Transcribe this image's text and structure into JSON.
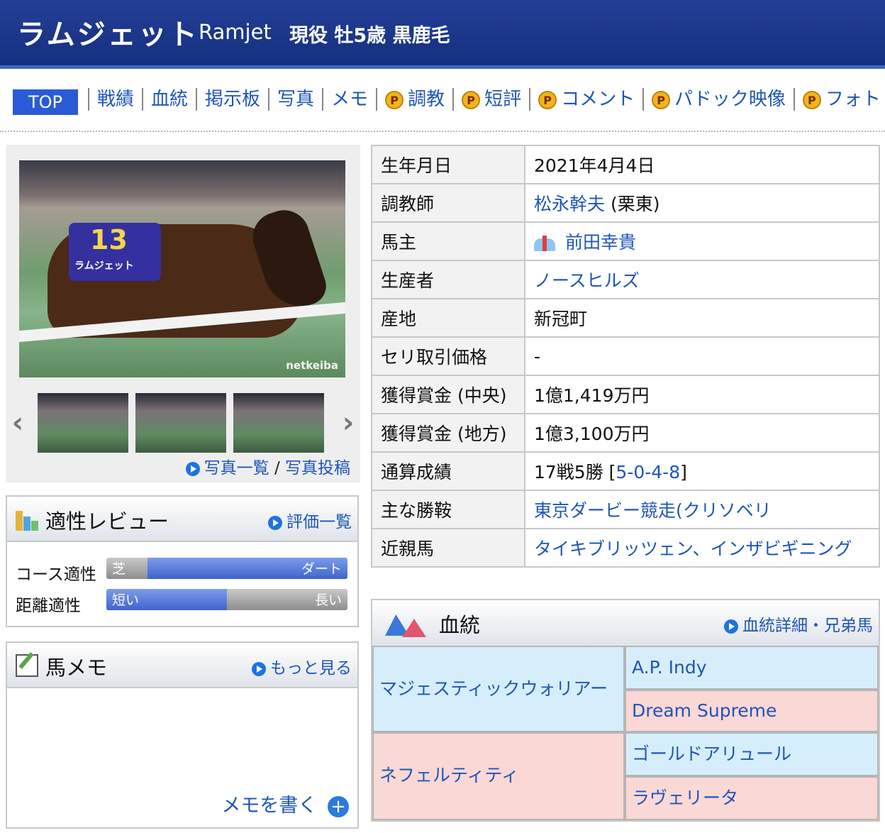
{
  "header": {
    "name_jp": "ラムジェット",
    "name_en": "Ramjet",
    "status": "現役 牡5歳 黒鹿毛"
  },
  "nav": {
    "top": "TOP",
    "items": [
      "戦績",
      "血統",
      "掲示板",
      "写真",
      "メモ"
    ],
    "premium_items": [
      "調教",
      "短評",
      "コメント",
      "パドック映像",
      "フォト"
    ],
    "premium_badge": "P"
  },
  "photo": {
    "watermark": "netkeiba",
    "cloth_number": "13",
    "cloth_name": "ラムジェット",
    "links": [
      "写真一覧",
      "写真投稿"
    ],
    "separator": "/"
  },
  "aptitude": {
    "title": "適性レビュー",
    "link": "評価一覧",
    "rows": [
      {
        "label": "コース適性",
        "left": "芝",
        "right": "ダート",
        "value": 0.83
      },
      {
        "label": "距離適性",
        "left": "短い",
        "right": "長い",
        "value": 0.5
      }
    ]
  },
  "memo": {
    "title": "馬メモ",
    "link": "もっと見る",
    "write": "メモを書く"
  },
  "info": [
    {
      "key": "生年月日",
      "value": "2021年4月4日"
    },
    {
      "key": "調教師",
      "value": "松永幹夫",
      "suffix": " (栗東)"
    },
    {
      "key": "馬主",
      "value": "前田幸貴"
    },
    {
      "key": "生産者",
      "value": "ノースヒルズ"
    },
    {
      "key": "産地",
      "value": "新冠町"
    },
    {
      "key": "セリ取引価格",
      "value": "-"
    },
    {
      "key": "獲得賞金 (中央)",
      "value": "1億1,419万円"
    },
    {
      "key": "獲得賞金 (地方)",
      "value": "1億3,100万円"
    },
    {
      "key": "通算成績",
      "value": "17戦5勝 [",
      "record": "5-0-4-8",
      "suffix": "]"
    },
    {
      "key": "主な勝鞍",
      "value": "東京ダービー競走(クリソベリ"
    },
    {
      "key": "近親馬",
      "value": "タイキブリッツェン、インザビギニング"
    }
  ],
  "pedigree": {
    "title": "血統",
    "link": "血統詳細・兄弟馬",
    "sire": "マジェスティックウォリアー",
    "dam": "ネフェルティティ",
    "sire_sire": "A.P. Indy",
    "sire_dam": "Dream Supreme",
    "dam_sire": "ゴールドアリュール",
    "dam_dam": "ラヴェリータ"
  },
  "colors": {
    "header": "#1c3a8c",
    "link": "#1f55b8",
    "accent": "#2a5bd7",
    "pedigree_male": "#d6eefb",
    "pedigree_female": "#fad8d5"
  }
}
